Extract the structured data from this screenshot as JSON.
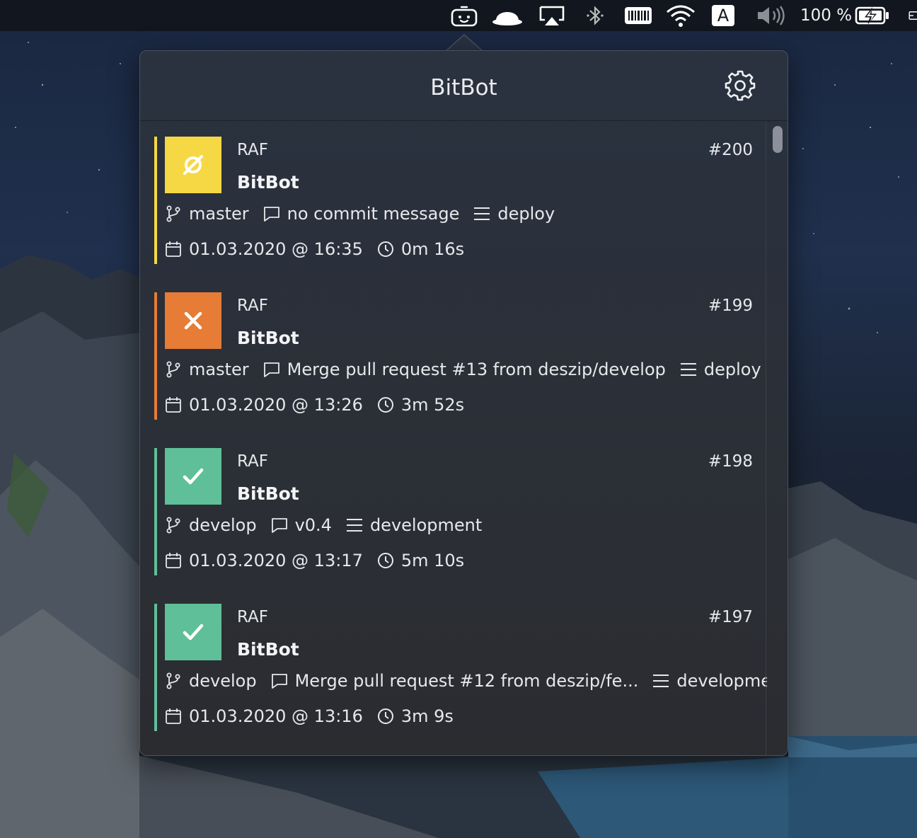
{
  "menubar": {
    "battery_percent": "100 %",
    "keyboard_input": "A"
  },
  "popover": {
    "title": "BitBot"
  },
  "colors": {
    "running": "#f6d845",
    "failed": "#e67c35",
    "success": "#5fbf98"
  },
  "builds": [
    {
      "status": "running",
      "status_icon": "prohibited-icon",
      "owner": "RAF",
      "repo": "BitBot",
      "number": "#200",
      "branch": "master",
      "message": "no commit message",
      "pipeline": "deploy",
      "date": "01.03.2020 @ 16:35",
      "duration": "0m 16s"
    },
    {
      "status": "failed",
      "status_icon": "x-icon",
      "owner": "RAF",
      "repo": "BitBot",
      "number": "#199",
      "branch": "master",
      "message": "Merge pull request #13 from deszip/develop",
      "pipeline": "deploy",
      "date": "01.03.2020 @ 13:26",
      "duration": "3m 52s"
    },
    {
      "status": "success",
      "status_icon": "checkmark-icon",
      "owner": "RAF",
      "repo": "BitBot",
      "number": "#198",
      "branch": "develop",
      "message": "v0.4",
      "pipeline": "development",
      "date": "01.03.2020 @ 13:17",
      "duration": "5m 10s"
    },
    {
      "status": "success",
      "status_icon": "checkmark-icon",
      "owner": "RAF",
      "repo": "BitBot",
      "number": "#197",
      "branch": "develop",
      "message": "Merge pull request #12 from deszip/fe...",
      "pipeline": "development",
      "date": "01.03.2020 @ 13:16",
      "duration": "3m 9s"
    }
  ]
}
